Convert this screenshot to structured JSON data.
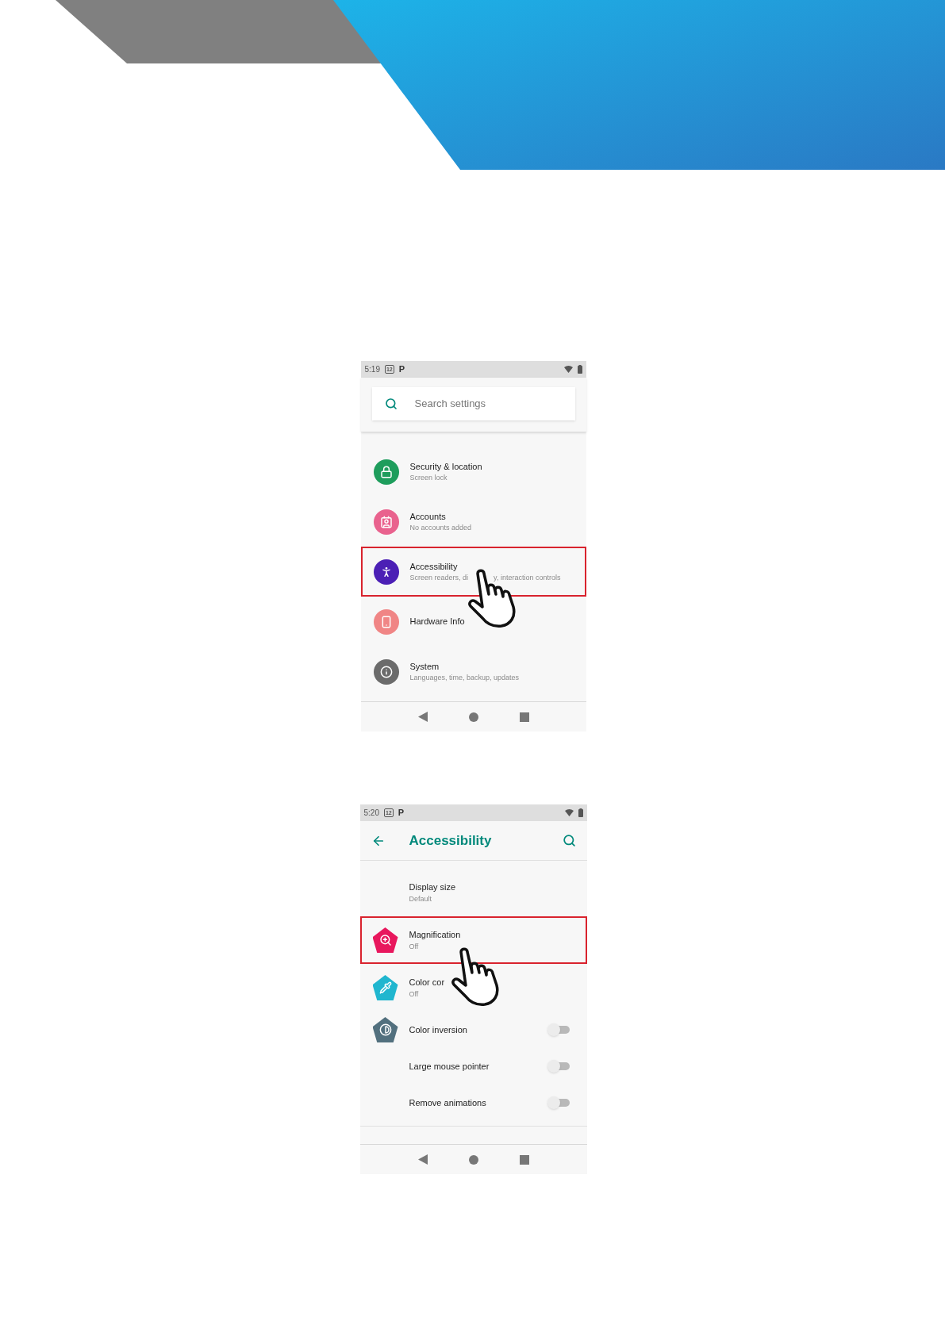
{
  "screens": [
    {
      "kind": "settings",
      "status_bar": {
        "time": "5:19",
        "badge": "12",
        "app_letter": "P"
      },
      "search": {
        "placeholder": "Search settings"
      },
      "items": [
        {
          "color": "#1e9d5c",
          "title": [
            "Security & location"
          ],
          "subtitle": [
            "Screen lock"
          ],
          "highlighted": false
        },
        {
          "color": "#e9628e",
          "title": [
            "Accounts"
          ],
          "subtitle": [
            "No accounts added"
          ],
          "highlighted": false
        },
        {
          "color": "#4b1fb5",
          "title": [
            "Accessibility"
          ],
          "subtitle": [
            "Screen readers, di",
            "y, interaction controls"
          ],
          "highlighted": true
        },
        {
          "color": "#f08585",
          "title": [
            "Hardware Info"
          ],
          "highlighted": false
        },
        {
          "color": "#6b6b6b",
          "title": [
            "System"
          ],
          "subtitle": [
            "Languages, time, backup, updates"
          ],
          "highlighted": false
        }
      ]
    },
    {
      "kind": "accessibility",
      "status_bar": {
        "time": "5:20",
        "badge": "12",
        "app_letter": "P"
      },
      "toolbar": {
        "title": "Accessibility"
      },
      "items": [
        {
          "title": [
            "Display size"
          ],
          "subtitle": [
            "Default"
          ],
          "highlighted": false
        },
        {
          "color": "#e8175d",
          "title": [
            "Magnification"
          ],
          "subtitle": [
            "Off"
          ],
          "highlighted": true
        },
        {
          "color": "#20b6cf",
          "title": [
            "Color cor"
          ],
          "subtitle": [
            "Off"
          ],
          "highlighted": false
        },
        {
          "color": "#52707e",
          "title": [
            "Color inversion"
          ],
          "on": false,
          "highlighted": false
        },
        {
          "title": [
            "Large mouse pointer"
          ],
          "on": false,
          "highlighted": false
        },
        {
          "title": [
            "Remove animations"
          ],
          "on": false,
          "highlighted": false
        }
      ]
    }
  ]
}
